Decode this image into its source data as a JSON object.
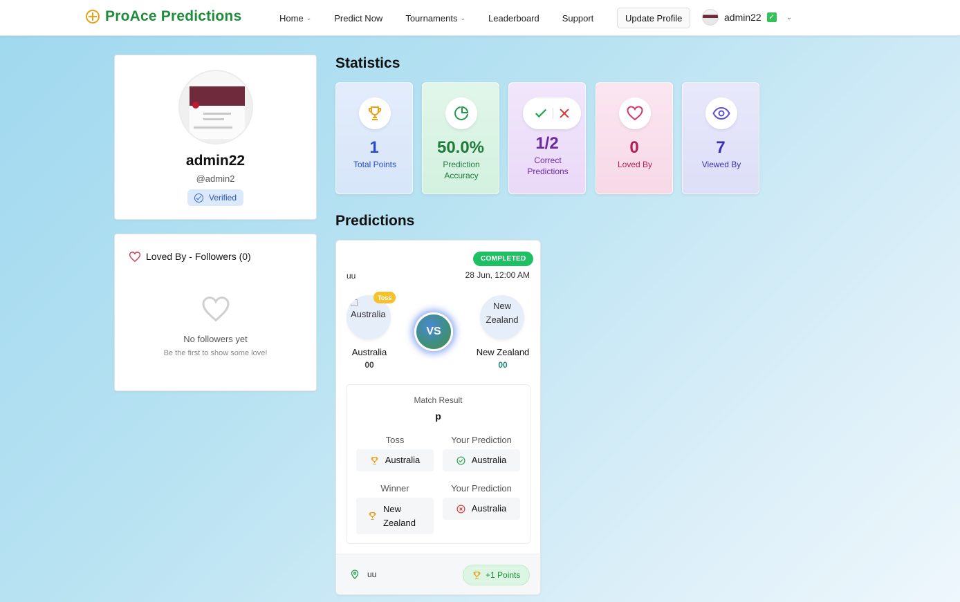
{
  "nav": {
    "brand": "ProAce Predictions",
    "items": [
      {
        "label": "Home",
        "dropdown": true
      },
      {
        "label": "Predict Now",
        "dropdown": false
      },
      {
        "label": "Tournaments",
        "dropdown": true
      },
      {
        "label": "Leaderboard",
        "dropdown": false
      },
      {
        "label": "Support",
        "dropdown": false
      }
    ],
    "update_profile": "Update Profile",
    "username": "admin22",
    "verified_mark": "✓"
  },
  "profile": {
    "name": "admin22",
    "handle": "@admin2",
    "badge": "Verified"
  },
  "followers": {
    "title": "Loved By - Followers (0)",
    "empty_title": "No followers yet",
    "empty_sub": "Be the first to show some love!"
  },
  "statistics": {
    "title": "Statistics",
    "cards": [
      {
        "value": "1",
        "label": "Total Points",
        "icon": "trophy-icon"
      },
      {
        "value": "50.0%",
        "label": "Prediction Accuracy",
        "icon": "pie-chart-icon"
      },
      {
        "value": "1/2",
        "label": "Correct Predictions",
        "icon": "check-cross-icon"
      },
      {
        "value": "0",
        "label": "Loved By",
        "icon": "heart-icon"
      },
      {
        "value": "7",
        "label": "Viewed By",
        "icon": "eye-icon"
      }
    ]
  },
  "predictions": {
    "title": "Predictions",
    "card": {
      "status": "COMPLETED",
      "league": "uu",
      "date": "28 Jun, 12:00 AM",
      "toss_tag": "Toss",
      "vs": "VS",
      "team1": {
        "name": "Australia",
        "score": "00",
        "logo_alt": "Australia"
      },
      "team2": {
        "name": "New Zealand",
        "score": "00",
        "logo_alt": "New Zealand"
      },
      "result_label": "Match Result",
      "result_value": "p",
      "toss_label": "Toss",
      "toss_value": "Australia",
      "toss_prediction_label": "Your Prediction",
      "toss_prediction": "Australia",
      "winner_label": "Winner",
      "winner_value": "New Zealand",
      "winner_prediction_label": "Your Prediction",
      "winner_prediction": "Australia",
      "venue": "uu",
      "points": "+1 Points"
    }
  },
  "colors": {
    "brand": "#1e8c3a",
    "accent": "#e8a21a",
    "completed": "#1fbf63"
  }
}
